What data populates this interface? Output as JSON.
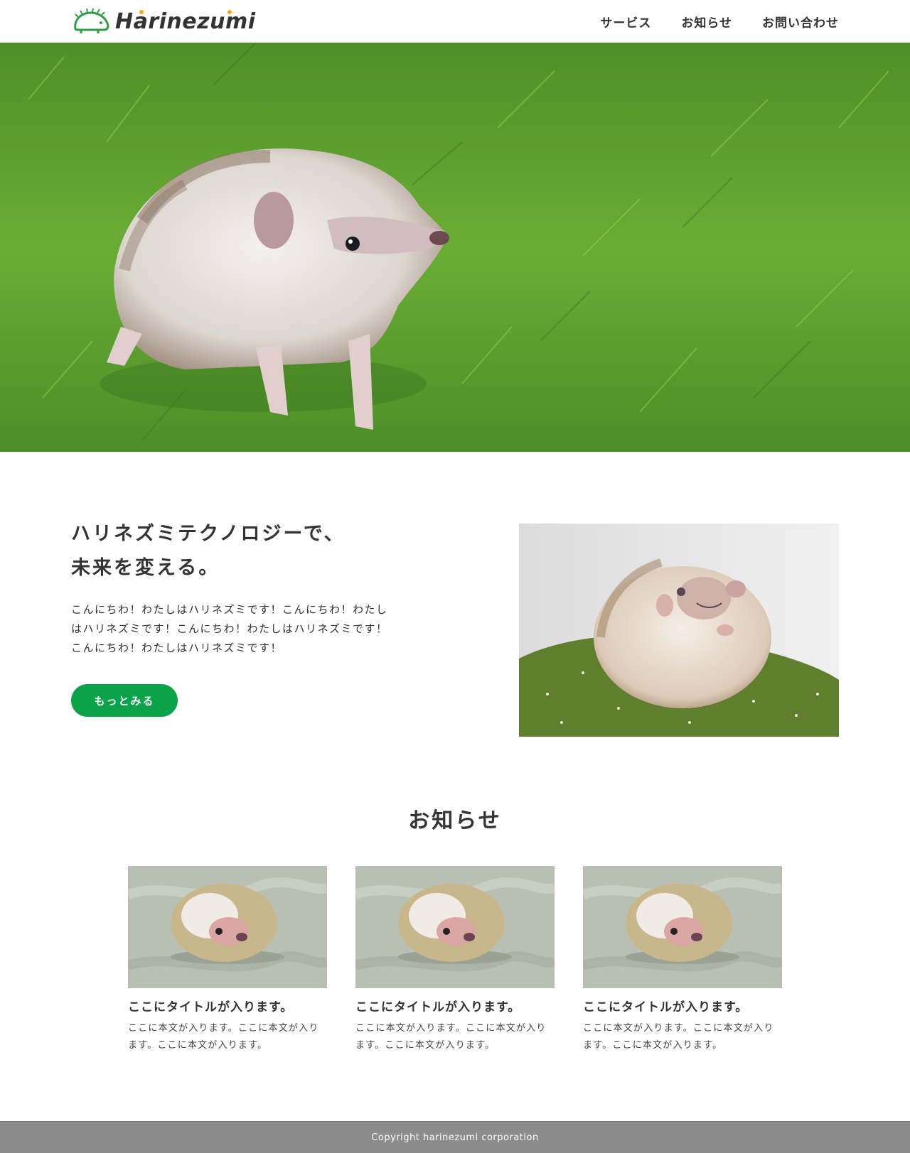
{
  "header": {
    "logo_text": "Harinezumi",
    "nav": [
      {
        "label": "サービス"
      },
      {
        "label": "お知らせ"
      },
      {
        "label": "お問い合わせ"
      }
    ]
  },
  "about": {
    "title_line1": "ハリネズミテクノロジーで、",
    "title_line2": "未来を変える。",
    "text": "こんにちわ！わたしはハリネズミです！こんにちわ！わたしはハリネズミです！こんにちわ！わたしはハリネズミです！こんにちわ！わたしはハリネズミです！",
    "button_label": "もっとみる"
  },
  "news": {
    "heading": "お知らせ",
    "cards": [
      {
        "title": "ここにタイトルが入ります。",
        "text": "ここに本文が入ります。ここに本文が入ります。ここに本文が入ります。"
      },
      {
        "title": "ここにタイトルが入ります。",
        "text": "ここに本文が入ります。ここに本文が入ります。ここに本文が入ります。"
      },
      {
        "title": "ここにタイトルが入ります。",
        "text": "ここに本文が入ります。ここに本文が入ります。ここに本文が入ります。"
      }
    ]
  },
  "footer": {
    "copyright": "Copyright harinezumi corporation"
  },
  "colors": {
    "accent": "#0aa34a",
    "logo_accent": "#f2a81d",
    "footer_bg": "#8c8c8c",
    "text": "#333333"
  }
}
